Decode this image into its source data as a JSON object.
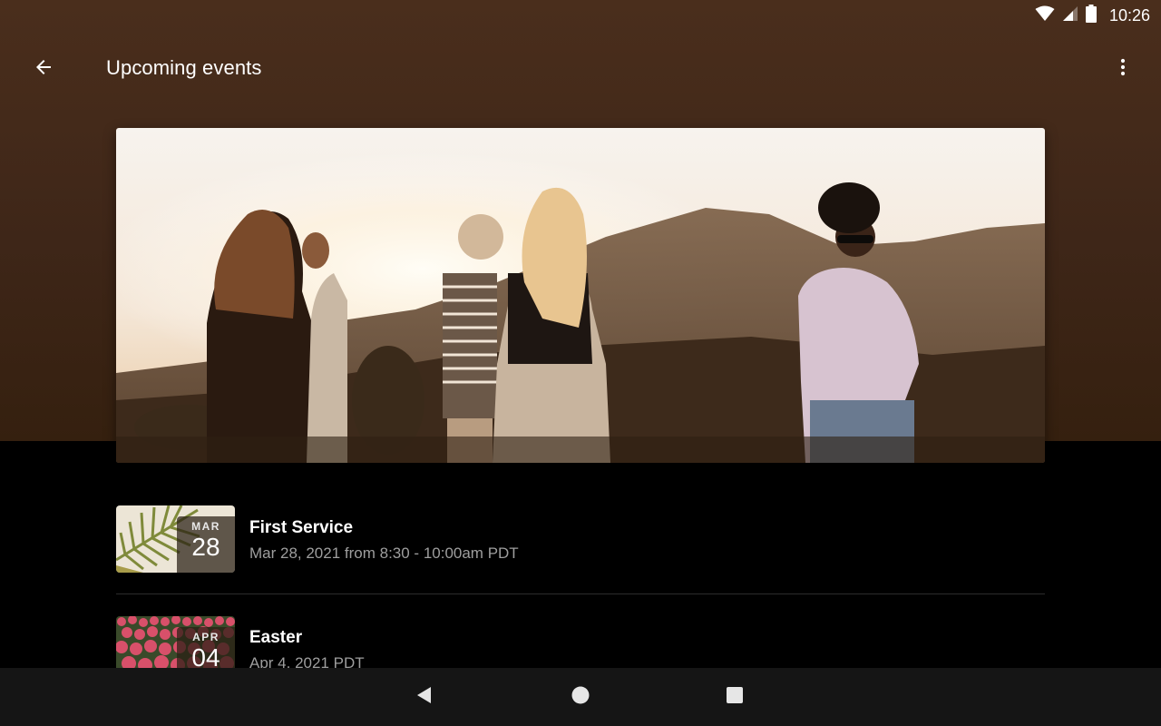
{
  "status_bar": {
    "time": "10:26",
    "icons": [
      "wifi-icon",
      "signal-icon",
      "battery-icon"
    ]
  },
  "app_bar": {
    "title": "Upcoming events",
    "back_icon": "arrow-back-icon",
    "menu_icon": "more-vert-icon"
  },
  "hero": {
    "image": "group-of-friends-at-sunset-photo"
  },
  "events": [
    {
      "title": "First Service",
      "subtitle": "Mar 28, 2021 from 8:30 - 10:00am PDT",
      "month": "MAR",
      "day": "28",
      "thumb": "palm-leaf-photo"
    },
    {
      "title": "Easter",
      "subtitle": "Apr 4, 2021 PDT",
      "month": "APR",
      "day": "04",
      "thumb": "tulip-field-photo"
    }
  ],
  "nav_bar": {
    "icons": [
      "nav-back-icon",
      "nav-home-icon",
      "nav-recents-icon"
    ]
  },
  "colors": {
    "header_bg": "#4a2e1c",
    "page_bg": "#000000",
    "nav_bg": "#151515",
    "title_text": "#ffffff",
    "subtitle_text": "#9e9e9e"
  }
}
